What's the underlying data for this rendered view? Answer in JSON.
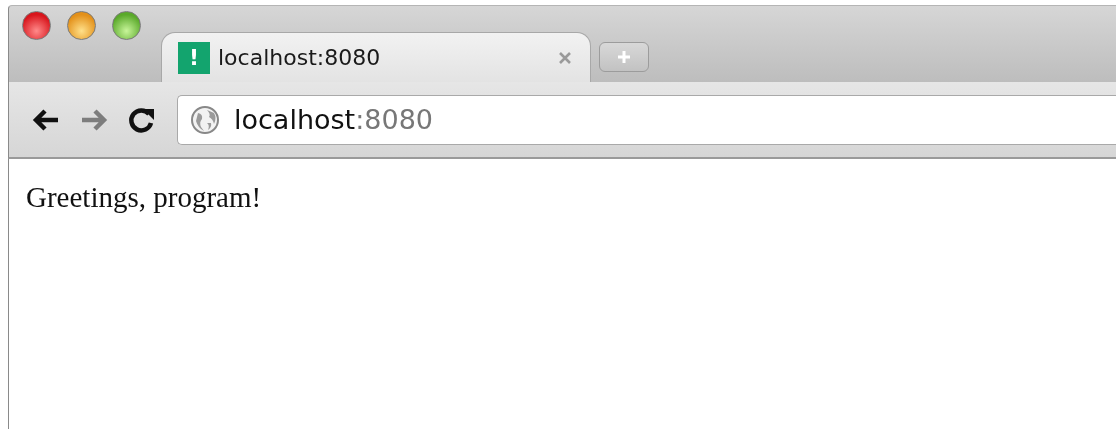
{
  "tabs": [
    {
      "favicon": "!",
      "title": "localhost:8080",
      "selected": true
    }
  ],
  "nav_buttons": [
    {
      "kind": "back",
      "disabled": false
    },
    {
      "kind": "forward",
      "disabled": true
    },
    {
      "kind": "reload",
      "disabled": false
    }
  ],
  "address_bar": {
    "host": "localhost",
    "port": ":8080"
  },
  "page": {
    "text": "Greetings, program!"
  }
}
